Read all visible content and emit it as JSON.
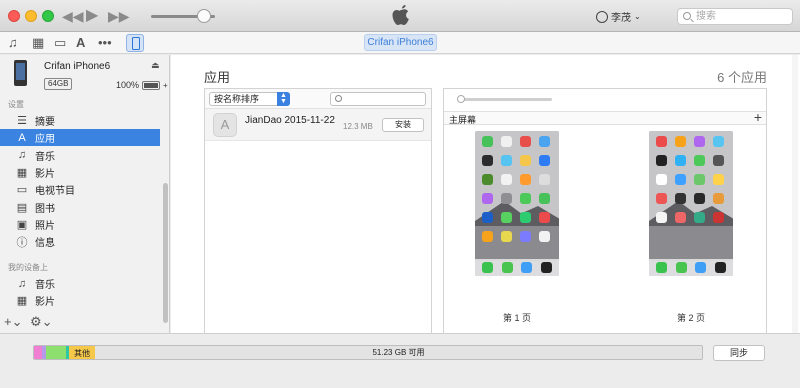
{
  "titlebar": {
    "user_name": "李茂",
    "search_placeholder": "搜索"
  },
  "device_tab": "Crifan iPhone6",
  "sidebar": {
    "device_name": "Crifan iPhone6",
    "capacity": "64GB",
    "battery": "100%",
    "battery_level": 1.0,
    "settings_header": "设置",
    "settings_items": [
      {
        "label": "摘要",
        "icon": "list-icon"
      },
      {
        "label": "应用",
        "icon": "app-store-icon",
        "active": true
      },
      {
        "label": "音乐",
        "icon": "music-note-icon"
      },
      {
        "label": "影片",
        "icon": "film-icon"
      },
      {
        "label": "电视节目",
        "icon": "tv-icon"
      },
      {
        "label": "图书",
        "icon": "book-icon"
      },
      {
        "label": "照片",
        "icon": "camera-icon"
      },
      {
        "label": "信息",
        "icon": "info-icon"
      }
    ],
    "on_device_header": "我的设备上",
    "on_device_items": [
      {
        "label": "音乐",
        "icon": "music-note-icon"
      },
      {
        "label": "影片",
        "icon": "film-icon"
      }
    ]
  },
  "main": {
    "title": "应用",
    "count": "6 个应用",
    "sort_label": "按名称排序",
    "apps": [
      {
        "name": "JianDao 2015-11-22",
        "size": "12.3 MB",
        "action": "安装"
      }
    ],
    "home_header": "主屏幕",
    "pages": [
      "第 1 页",
      "第 2 页"
    ]
  },
  "storage": {
    "other_label": "其他",
    "free_label": "51.23 GB 可用",
    "sync_label": "同步",
    "colors": {
      "pink": "#f07fd4",
      "purple": "#b49ae8",
      "green": "#8ee06e",
      "teal": "#2ec7a3",
      "other": "#f5c84a",
      "free": "#e3e3e3"
    }
  }
}
